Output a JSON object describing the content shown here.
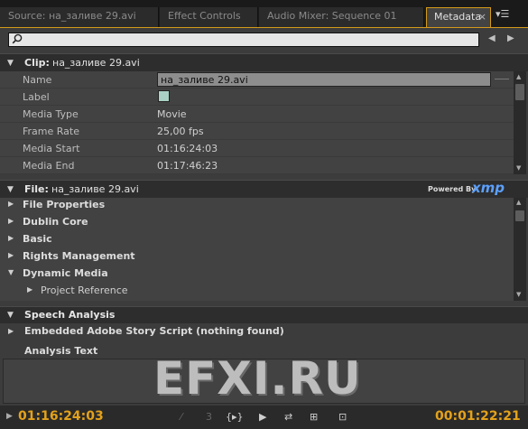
{
  "tabs": [
    {
      "label": "Source: на_заливе 29.avi"
    },
    {
      "label": "Effect Controls"
    },
    {
      "label": "Audio Mixer: Sequence 01"
    },
    {
      "label": "Metadata",
      "active": true
    }
  ],
  "tab_close": "×",
  "tab_menu": "▾☰",
  "search": {
    "placeholder": ""
  },
  "clip": {
    "label": "Clip:",
    "value": "на_заливе 29.avi",
    "rows": [
      {
        "key": "Name",
        "value": "на_заливе 29.avi"
      },
      {
        "key": "Label",
        "value": ""
      },
      {
        "key": "Media Type",
        "value": "Movie"
      },
      {
        "key": "Frame Rate",
        "value": "25,00 fps"
      },
      {
        "key": "Media Start",
        "value": "01:16:24:03"
      },
      {
        "key": "Media End",
        "value": "01:17:46:23"
      }
    ],
    "label_color": "#a9d0c4"
  },
  "file": {
    "label": "File:",
    "value": "на_заливе 29.avi",
    "powered_by": "Powered By",
    "xmp": "xmp",
    "groups": [
      "File Properties",
      "Dublin Core",
      "Basic",
      "Rights Management",
      "Dynamic Media"
    ],
    "sub_item": "Project Reference"
  },
  "speech": {
    "label": "Speech Analysis",
    "script": "Embedded Adobe Story Script (nothing found)",
    "analysis_text": "Analysis Text"
  },
  "watermark": "EFXI.RU",
  "timecode_left": "01:16:24:03",
  "timecode_right": "00:01:22:21",
  "accent_color": "#e4a21a"
}
